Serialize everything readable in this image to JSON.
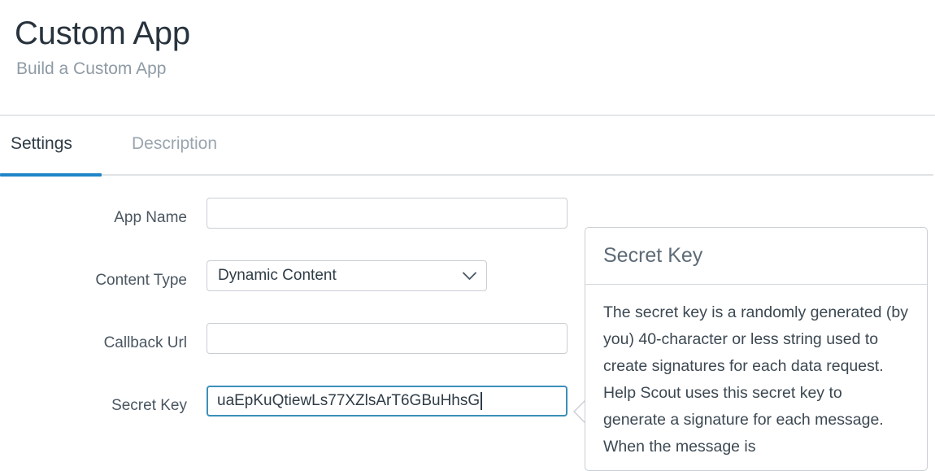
{
  "header": {
    "title": "Custom App",
    "subtitle": "Build a Custom App"
  },
  "tabs": [
    {
      "label": "Settings",
      "active": true
    },
    {
      "label": "Description",
      "active": false
    }
  ],
  "form": {
    "fields": [
      {
        "label": "App Name",
        "value": "",
        "placeholder": "",
        "type": "text"
      },
      {
        "label": "Content Type",
        "value": "Dynamic Content",
        "type": "select"
      },
      {
        "label": "Callback Url",
        "value": "",
        "placeholder": "",
        "type": "text"
      },
      {
        "label": "Secret Key",
        "value": "uaEpKuQtiewLs77XZlsArT6GBuHhsG",
        "type": "text",
        "focused": true
      }
    ],
    "content_type_options": [
      "Dynamic Content"
    ]
  },
  "popover": {
    "title": "Secret Key",
    "body": "The secret key is a randomly generated (by you) 40-character or less string used to create signatures for each data request. Help Scout uses this secret key to generate a signature for each message. When the message is"
  },
  "icons": {
    "chevron_down": "chevron-down-icon"
  },
  "colors": {
    "accent": "#1f86c9",
    "focus_border": "#3d8fb8",
    "border": "#c9ced3",
    "text": "#2f3c46",
    "muted_text": "#8e9ba5"
  }
}
